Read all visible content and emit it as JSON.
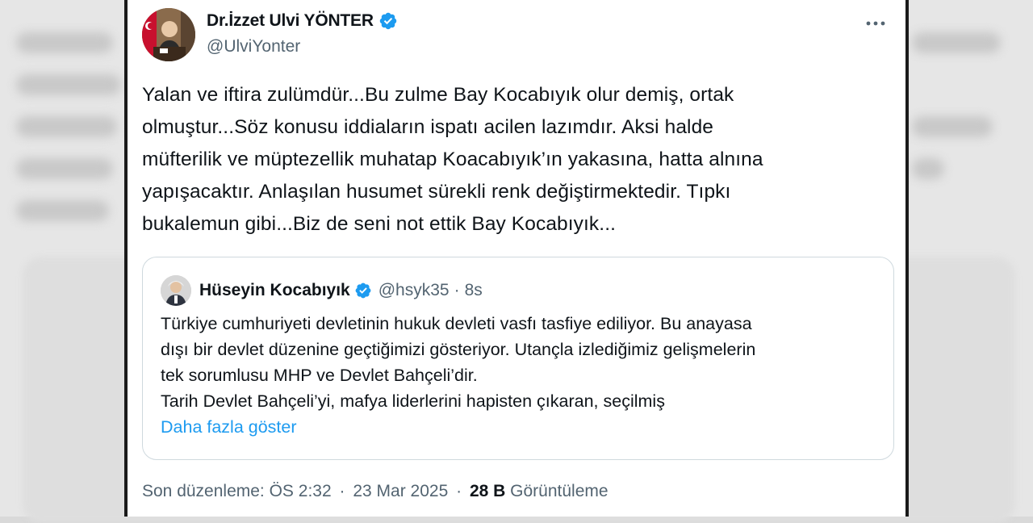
{
  "tweet": {
    "author_name": "Dr.İzzet Ulvi YÖNTER",
    "author_handle": "@UlviYonter",
    "body_lines": [
      "Yalan ve iftira zulümdür...Bu zulme Bay Kocabıyık olur demiş, ortak",
      "olmuştur...Söz konusu iddiaların ispatı acilen lazımdır. Aksi halde",
      "müfterilik ve müptezellik muhatap Koacabıyık’ın yakasına, hatta alnına",
      "yapışacaktır. Anlaşılan husumet sürekli renk değiştirmektedir. Tıpkı",
      "bukalemun gibi...Biz de seni not ettik Bay Kocabıyık..."
    ],
    "more_icon": "more-horizontal-icon",
    "verified_icon": "verified-badge-icon"
  },
  "quote": {
    "author_name": "Hüseyin Kocabıyık",
    "author_handle": "@hsyk35",
    "time": "8s",
    "separator": "·",
    "lines": [
      "Türkiye cumhuriyeti devletinin hukuk devleti vasfı tasfiye ediliyor. Bu anayasa",
      "dışı bir devlet düzenine geçtiğimizi gösteriyor. Utançla izlediğimiz gelişmelerin",
      "tek sorumlusu MHP ve Devlet Bahçeli’dir.",
      "Tarih Devlet Bahçeli’yi, mafya liderlerini hapisten çıkaran, seçilmiş"
    ],
    "show_more": "Daha fazla göster"
  },
  "meta": {
    "edited_label": "Son düzenleme: ÖS 2:32",
    "dot": "·",
    "date": "23 Mar 2025",
    "views_count": "28 B",
    "views_label": "Görüntüleme"
  },
  "colors": {
    "verified": "#1d9bf0",
    "link": "#1d9bf0",
    "text": "#0f1419",
    "secondary": "#536471"
  }
}
